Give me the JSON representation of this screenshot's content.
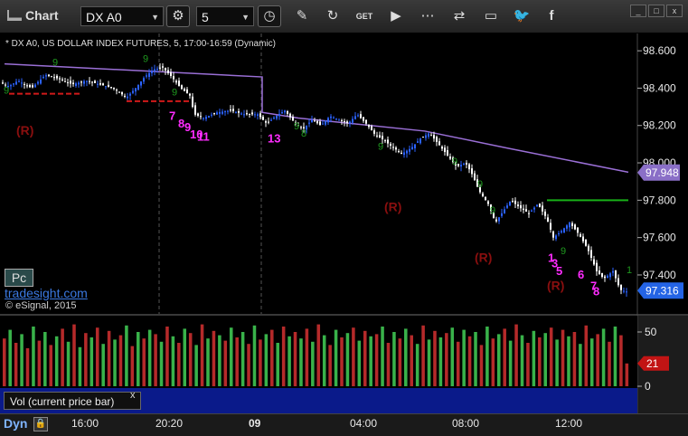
{
  "toolbar": {
    "title": "Chart",
    "symbol": "DX A0",
    "interval": "5",
    "window_buttons": [
      "_",
      "□",
      "x"
    ],
    "tools": [
      "settings-icon",
      "clock-icon",
      "pencil-icon",
      "refresh-icon",
      "get-icon",
      "play-icon",
      "link-icon",
      "comment-icon",
      "twitter-icon",
      "facebook-icon"
    ]
  },
  "chart_data": {
    "type": "candlestick",
    "title": "* DX A0, US DOLLAR INDEX FUTURES, 5, 17:00-16:59 (Dynamic)",
    "ylim": [
      97.2,
      98.7
    ],
    "yticks": [
      "98.600",
      "98.400",
      "98.200",
      "98.000",
      "97.800",
      "97.600",
      "97.400"
    ],
    "last_price": "97.316",
    "marker_price": "97.948",
    "price_path": [
      [
        0,
        98.43
      ],
      [
        10,
        98.41
      ],
      [
        20,
        98.44
      ],
      [
        35,
        98.4
      ],
      [
        50,
        98.47
      ],
      [
        65,
        98.45
      ],
      [
        80,
        98.42
      ],
      [
        95,
        98.44
      ],
      [
        110,
        98.42
      ],
      [
        125,
        98.4
      ],
      [
        140,
        98.35
      ],
      [
        150,
        98.4
      ],
      [
        160,
        98.46
      ],
      [
        170,
        98.5
      ],
      [
        180,
        98.51
      ],
      [
        190,
        98.46
      ],
      [
        200,
        98.4
      ],
      [
        210,
        98.36
      ],
      [
        215,
        98.26
      ],
      [
        225,
        98.24
      ],
      [
        240,
        98.27
      ],
      [
        255,
        98.28
      ],
      [
        270,
        98.26
      ],
      [
        285,
        98.26
      ],
      [
        295,
        98.21
      ],
      [
        305,
        98.25
      ],
      [
        315,
        98.28
      ],
      [
        325,
        98.22
      ],
      [
        335,
        98.18
      ],
      [
        345,
        98.23
      ],
      [
        355,
        98.2
      ],
      [
        365,
        98.25
      ],
      [
        375,
        98.23
      ],
      [
        385,
        98.21
      ],
      [
        395,
        98.26
      ],
      [
        405,
        98.21
      ],
      [
        415,
        98.15
      ],
      [
        425,
        98.12
      ],
      [
        435,
        98.08
      ],
      [
        445,
        98.05
      ],
      [
        455,
        98.08
      ],
      [
        465,
        98.13
      ],
      [
        475,
        98.16
      ],
      [
        485,
        98.1
      ],
      [
        495,
        98.04
      ],
      [
        505,
        97.98
      ],
      [
        515,
        98.0
      ],
      [
        522,
        97.94
      ],
      [
        530,
        97.85
      ],
      [
        540,
        97.78
      ],
      [
        548,
        97.68
      ],
      [
        555,
        97.73
      ],
      [
        565,
        97.8
      ],
      [
        575,
        97.76
      ],
      [
        585,
        97.73
      ],
      [
        595,
        97.78
      ],
      [
        605,
        97.7
      ],
      [
        612,
        97.6
      ],
      [
        620,
        97.63
      ],
      [
        630,
        97.68
      ],
      [
        640,
        97.62
      ],
      [
        650,
        97.54
      ],
      [
        660,
        97.42
      ],
      [
        668,
        97.38
      ],
      [
        678,
        97.42
      ],
      [
        686,
        97.32
      ],
      [
        694,
        97.31
      ]
    ],
    "ma_line": [
      [
        5,
        98.53
      ],
      [
        290,
        98.46
      ],
      [
        290,
        98.27
      ],
      [
        330,
        98.24
      ],
      [
        470,
        98.17
      ],
      [
        560,
        98.08
      ],
      [
        695,
        97.95
      ]
    ],
    "red_levels": [
      [
        10,
        90,
        98.37
      ],
      [
        140,
        210,
        98.33
      ]
    ],
    "green_level": [
      605,
      695,
      97.8
    ],
    "annotations": {
      "r": [
        {
          "x": 30,
          "y": 98.15
        },
        {
          "x": 437,
          "y": 97.74
        },
        {
          "x": 537,
          "y": 97.47
        },
        {
          "x": 617,
          "y": 97.32
        }
      ],
      "magenta": [
        {
          "x": 187,
          "y": 98.23,
          "t": "7"
        },
        {
          "x": 197,
          "y": 98.19,
          "t": "8"
        },
        {
          "x": 204,
          "y": 98.17,
          "t": "9"
        },
        {
          "x": 210,
          "y": 98.13,
          "t": "10"
        },
        {
          "x": 218,
          "y": 98.12,
          "t": "11"
        },
        {
          "x": 296,
          "y": 98.11,
          "t": "13"
        },
        {
          "x": 606,
          "y": 97.47,
          "t": "1"
        },
        {
          "x": 610,
          "y": 97.44,
          "t": "3"
        },
        {
          "x": 615,
          "y": 97.4,
          "t": "5"
        },
        {
          "x": 639,
          "y": 97.38,
          "t": "6"
        },
        {
          "x": 653,
          "y": 97.32,
          "t": "7"
        },
        {
          "x": 656,
          "y": 97.29,
          "t": "8"
        }
      ],
      "green": [
        {
          "x": 4,
          "y": 98.37,
          "t": "9"
        },
        {
          "x": 58,
          "y": 98.52,
          "t": "9"
        },
        {
          "x": 158,
          "y": 98.54,
          "t": "9"
        },
        {
          "x": 190,
          "y": 98.36,
          "t": "9"
        },
        {
          "x": 325,
          "y": 98.18,
          "t": "9"
        },
        {
          "x": 333,
          "y": 98.14,
          "t": "8"
        },
        {
          "x": 418,
          "y": 98.07,
          "t": "9"
        },
        {
          "x": 500,
          "y": 97.99,
          "t": "9"
        },
        {
          "x": 528,
          "y": 97.87,
          "t": "9"
        },
        {
          "x": 542,
          "y": 97.73,
          "t": "9"
        },
        {
          "x": 620,
          "y": 97.51,
          "t": "9"
        },
        {
          "x": 693,
          "y": 97.41,
          "t": "1"
        }
      ]
    }
  },
  "volume": {
    "label": "Vol (current price bar)",
    "close": "x",
    "yticks": [
      "50",
      "0"
    ],
    "current": "21",
    "bars": [
      {
        "v": 44,
        "up": false
      },
      {
        "v": 52,
        "up": true
      },
      {
        "v": 40,
        "up": false
      },
      {
        "v": 48,
        "up": true
      },
      {
        "v": 35,
        "up": false
      },
      {
        "v": 55,
        "up": true
      },
      {
        "v": 42,
        "up": false
      },
      {
        "v": 50,
        "up": true
      },
      {
        "v": 38,
        "up": false
      },
      {
        "v": 46,
        "up": true
      },
      {
        "v": 53,
        "up": false
      },
      {
        "v": 41,
        "up": true
      },
      {
        "v": 57,
        "up": false
      },
      {
        "v": 36,
        "up": true
      },
      {
        "v": 49,
        "up": false
      },
      {
        "v": 45,
        "up": true
      },
      {
        "v": 54,
        "up": false
      },
      {
        "v": 39,
        "up": true
      },
      {
        "v": 51,
        "up": false
      },
      {
        "v": 43,
        "up": true
      },
      {
        "v": 47,
        "up": false
      },
      {
        "v": 56,
        "up": true
      },
      {
        "v": 37,
        "up": false
      },
      {
        "v": 50,
        "up": true
      },
      {
        "v": 44,
        "up": false
      },
      {
        "v": 52,
        "up": true
      },
      {
        "v": 48,
        "up": false
      },
      {
        "v": 41,
        "up": true
      },
      {
        "v": 55,
        "up": false
      },
      {
        "v": 46,
        "up": true
      },
      {
        "v": 40,
        "up": false
      },
      {
        "v": 53,
        "up": true
      },
      {
        "v": 49,
        "up": false
      },
      {
        "v": 38,
        "up": true
      },
      {
        "v": 57,
        "up": false
      },
      {
        "v": 44,
        "up": true
      },
      {
        "v": 51,
        "up": false
      },
      {
        "v": 47,
        "up": true
      },
      {
        "v": 42,
        "up": false
      },
      {
        "v": 54,
        "up": true
      },
      {
        "v": 45,
        "up": false
      },
      {
        "v": 50,
        "up": true
      },
      {
        "v": 39,
        "up": false
      },
      {
        "v": 56,
        "up": true
      },
      {
        "v": 43,
        "up": false
      },
      {
        "v": 48,
        "up": true
      },
      {
        "v": 52,
        "up": false
      },
      {
        "v": 40,
        "up": true
      },
      {
        "v": 55,
        "up": false
      },
      {
        "v": 46,
        "up": true
      },
      {
        "v": 50,
        "up": false
      },
      {
        "v": 44,
        "up": true
      },
      {
        "v": 53,
        "up": false
      },
      {
        "v": 41,
        "up": true
      },
      {
        "v": 57,
        "up": false
      },
      {
        "v": 47,
        "up": true
      },
      {
        "v": 38,
        "up": false
      },
      {
        "v": 52,
        "up": true
      },
      {
        "v": 45,
        "up": false
      },
      {
        "v": 49,
        "up": true
      },
      {
        "v": 54,
        "up": false
      },
      {
        "v": 42,
        "up": true
      },
      {
        "v": 51,
        "up": false
      },
      {
        "v": 46,
        "up": true
      },
      {
        "v": 48,
        "up": false
      },
      {
        "v": 55,
        "up": true
      },
      {
        "v": 40,
        "up": false
      },
      {
        "v": 50,
        "up": true
      },
      {
        "v": 44,
        "up": false
      },
      {
        "v": 53,
        "up": true
      },
      {
        "v": 47,
        "up": false
      },
      {
        "v": 39,
        "up": true
      },
      {
        "v": 56,
        "up": false
      },
      {
        "v": 43,
        "up": true
      },
      {
        "v": 51,
        "up": false
      },
      {
        "v": 45,
        "up": true
      },
      {
        "v": 49,
        "up": false
      },
      {
        "v": 54,
        "up": true
      },
      {
        "v": 41,
        "up": false
      },
      {
        "v": 52,
        "up": true
      },
      {
        "v": 46,
        "up": false
      },
      {
        "v": 50,
        "up": true
      },
      {
        "v": 38,
        "up": false
      },
      {
        "v": 55,
        "up": true
      },
      {
        "v": 44,
        "up": false
      },
      {
        "v": 48,
        "up": true
      },
      {
        "v": 53,
        "up": false
      },
      {
        "v": 42,
        "up": true
      },
      {
        "v": 57,
        "up": false
      },
      {
        "v": 47,
        "up": true
      },
      {
        "v": 40,
        "up": false
      },
      {
        "v": 51,
        "up": true
      },
      {
        "v": 45,
        "up": false
      },
      {
        "v": 49,
        "up": true
      },
      {
        "v": 54,
        "up": false
      },
      {
        "v": 43,
        "up": true
      },
      {
        "v": 52,
        "up": false
      },
      {
        "v": 46,
        "up": true
      },
      {
        "v": 50,
        "up": false
      },
      {
        "v": 39,
        "up": true
      },
      {
        "v": 56,
        "up": false
      },
      {
        "v": 44,
        "up": true
      },
      {
        "v": 48,
        "up": false
      },
      {
        "v": 53,
        "up": true
      },
      {
        "v": 41,
        "up": false
      },
      {
        "v": 55,
        "up": true
      },
      {
        "v": 47,
        "up": false
      },
      {
        "v": 21,
        "up": false
      }
    ]
  },
  "labels": {
    "tradesight": "tradesight.com",
    "copyright": "© eSignal, 2015",
    "stamp": "Pc",
    "mode": "Dyn"
  },
  "xaxis": {
    "ticks": [
      {
        "label": "16:00",
        "x": 93,
        "bold": false
      },
      {
        "label": "20:20",
        "x": 186,
        "bold": false
      },
      {
        "label": "09",
        "x": 289,
        "bold": true
      },
      {
        "label": "04:00",
        "x": 401,
        "bold": false
      },
      {
        "label": "08:00",
        "x": 514,
        "bold": false
      },
      {
        "label": "12:00",
        "x": 628,
        "bold": false
      }
    ]
  },
  "colors": {
    "background": "#000000",
    "ma": "#9a6fd6",
    "up": "#2b62ff",
    "down": "#ffffff",
    "red_level": "#d11a1a",
    "green_level": "#18b018",
    "last_price_box": "#2464e6",
    "marker_box": "#8a6fc7",
    "vol_up": "#39b24a",
    "vol_down": "#b52a2a"
  }
}
